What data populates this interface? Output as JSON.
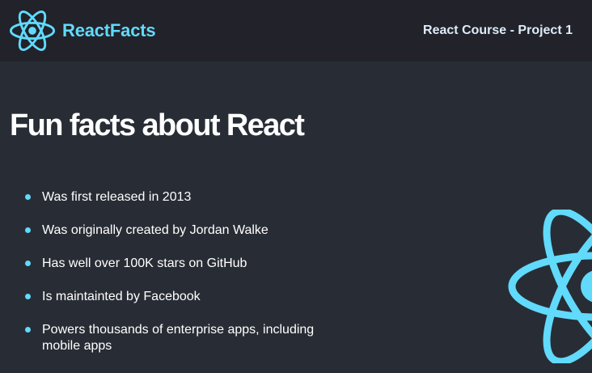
{
  "navbar": {
    "logo_icon": "react-atom-icon",
    "brand": "ReactFacts",
    "title": "React Course - Project 1"
  },
  "main": {
    "title": "Fun facts about React",
    "facts": [
      "Was first released in 2013",
      "Was originally created by Jordan Walke",
      "Has well over 100K stars on GitHub",
      "Is maintainted by Facebook",
      "Powers thousands of enterprise apps, including mobile apps"
    ],
    "background_icon": "react-atom-icon"
  },
  "colors": {
    "accent": "#61dafb",
    "navbar_bg": "#21222a",
    "page_bg": "#282d35",
    "text": "#ffffff",
    "nav_title": "#deebf8"
  }
}
